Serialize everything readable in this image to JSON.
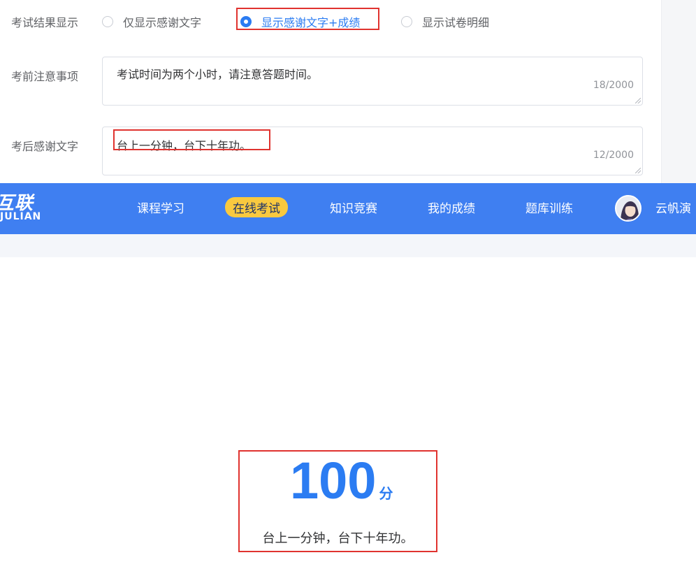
{
  "settings": {
    "result_display": {
      "label": "考试结果显示",
      "options": [
        {
          "label": "仅显示感谢文字",
          "selected": false
        },
        {
          "label": "显示感谢文字+成绩",
          "selected": true
        },
        {
          "label": "显示试卷明细",
          "selected": false
        }
      ]
    },
    "pre_notice": {
      "label": "考前注意事项",
      "value": "考试时间为两个小时，请注意答题时间。",
      "count": "18/2000"
    },
    "thanks_text": {
      "label": "考后感谢文字",
      "value": "台上一分钟，台下十年功。",
      "count": "12/2000"
    }
  },
  "nav": {
    "logo_main": "互联",
    "logo_sub": "JULIAN",
    "items": [
      "课程学习",
      "在线考试",
      "知识竞赛",
      "我的成绩",
      "题库训练"
    ],
    "active_index": 1,
    "user_name": "云帆演"
  },
  "result": {
    "score": "100",
    "score_unit": "分",
    "message": "台上一分钟，台下十年功。"
  },
  "colors": {
    "accent": "#2b7cf2",
    "nav_bg": "#3f7ff1",
    "active_tab": "#f9c93f",
    "highlight": "#e0332f"
  }
}
